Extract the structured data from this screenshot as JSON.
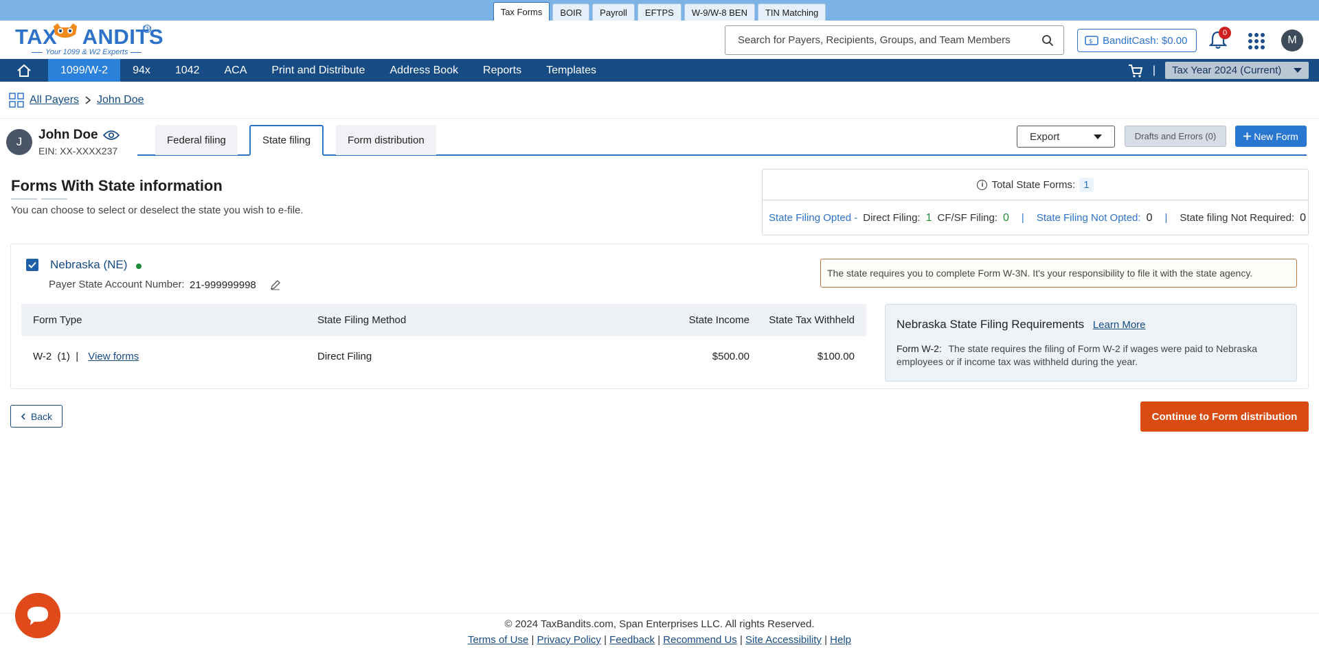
{
  "product_tabs": [
    {
      "label": "Tax Forms",
      "active": true
    },
    {
      "label": "BOIR"
    },
    {
      "label": "Payroll"
    },
    {
      "label": "EFTPS"
    },
    {
      "label": "W-9/W-8 BEN"
    },
    {
      "label": "TIN Matching"
    }
  ],
  "logo": {
    "tagline": "Your 1099 & W2 Experts",
    "tm": "TM"
  },
  "search": {
    "placeholder": "Search for Payers, Recipients, Groups, and Team Members"
  },
  "bandit_cash": {
    "label": "BanditCash: $0.00"
  },
  "notifications": {
    "count": "0"
  },
  "user": {
    "initial": "M"
  },
  "nav": {
    "items": [
      "1099/W-2",
      "94x",
      "1042",
      "ACA",
      "Print and Distribute",
      "Address Book",
      "Reports",
      "Templates"
    ],
    "active": "1099/W-2",
    "separator": "|",
    "tax_year": "Tax Year 2024 (Current)"
  },
  "breadcrumb": {
    "all_payers": "All Payers",
    "current": "John Doe"
  },
  "payer": {
    "initial": "J",
    "name": "John Doe",
    "ein": "EIN: XX-XXXX237"
  },
  "tabs": [
    "Federal filing",
    "State filing",
    "Form distribution"
  ],
  "actions": {
    "export": "Export",
    "drafts": "Drafts and Errors (0)",
    "new_form": "New Form"
  },
  "section": {
    "title": "Forms With State information",
    "subtitle": "You can choose to select or deselect the state you wish to e-file."
  },
  "summary": {
    "total_label": "Total State Forms:",
    "total_value": "1",
    "opted_label": "State Filing Opted -",
    "direct_label": "Direct Filing:",
    "direct_value": "1",
    "cfsf_label": "CF/SF Filing:",
    "cfsf_value": "0",
    "not_opted_label": "State Filing Not Opted:",
    "not_opted_value": "0",
    "not_required_label": "State filing Not Required:",
    "not_required_value": "0"
  },
  "state": {
    "name": "Nebraska (NE)",
    "account_label": "Payer State Account Number:",
    "account_value": "21-999999998",
    "note": "The state requires you to complete Form W-3N. It's your responsibility to file it with the state agency.",
    "table_headers": [
      "Form Type",
      "State Filing Method",
      "State Income",
      "State Tax Withheld"
    ],
    "rows": [
      {
        "form_type": "W-2  (1)  |",
        "view_link": "View forms",
        "method": "Direct Filing",
        "income": "$500.00",
        "withheld": "$100.00"
      }
    ],
    "requirements_title": "Nebraska State Filing Requirements",
    "learn_more": "Learn More",
    "requirements_form": "Form W-2:",
    "requirements_text": "The state requires the filing of Form W-2 if wages were paid to Nebraska employees or if income tax was withheld during the year."
  },
  "buttons": {
    "back": "Back",
    "continue": "Continue to Form distribution"
  },
  "footer": {
    "copyright": "© 2024 TaxBandits.com, Span Enterprises LLC. All rights Reserved.",
    "links": [
      "Terms of Use",
      "Privacy Policy",
      "Feedback",
      "Recommend Us",
      "Site Accessibility",
      "Help"
    ]
  },
  "colors": {
    "brand_blue": "#2d72c8",
    "nav_blue": "#174b84",
    "accent_orange": "#d94b11",
    "success_green": "#1e8c3a"
  }
}
